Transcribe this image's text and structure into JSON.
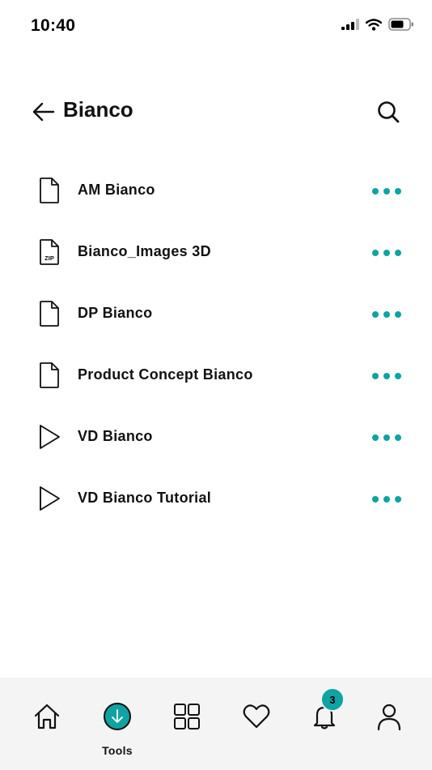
{
  "status_bar": {
    "time": "10:40",
    "icons": [
      "cellular-signal-icon",
      "wifi-icon",
      "battery-icon"
    ]
  },
  "header": {
    "title": "Bianco",
    "back_icon": "arrow-left-icon",
    "search_icon": "search-icon"
  },
  "files": [
    {
      "name": "AM Bianco",
      "icon": "document-icon"
    },
    {
      "name": "Bianco_Images 3D",
      "icon": "zip-file-icon",
      "icon_text": "ZIP"
    },
    {
      "name": "DP Bianco",
      "icon": "document-icon"
    },
    {
      "name": "Product Concept Bianco",
      "icon": "document-icon"
    },
    {
      "name": "VD Bianco",
      "icon": "play-icon"
    },
    {
      "name": "VD Bianco Tutorial",
      "icon": "play-icon"
    }
  ],
  "bottom_nav": {
    "items": [
      {
        "id": "home",
        "icon": "home-icon"
      },
      {
        "id": "tools",
        "icon": "download-circle-icon",
        "label": "Tools"
      },
      {
        "id": "grid",
        "icon": "grid-icon"
      },
      {
        "id": "favorites",
        "icon": "heart-icon"
      },
      {
        "id": "notifications",
        "icon": "bell-icon",
        "badge": "3"
      },
      {
        "id": "profile",
        "icon": "user-icon"
      }
    ]
  },
  "colors": {
    "accent": "#0fa3a3",
    "nav_background": "#f4f4f4",
    "text": "#111111"
  }
}
